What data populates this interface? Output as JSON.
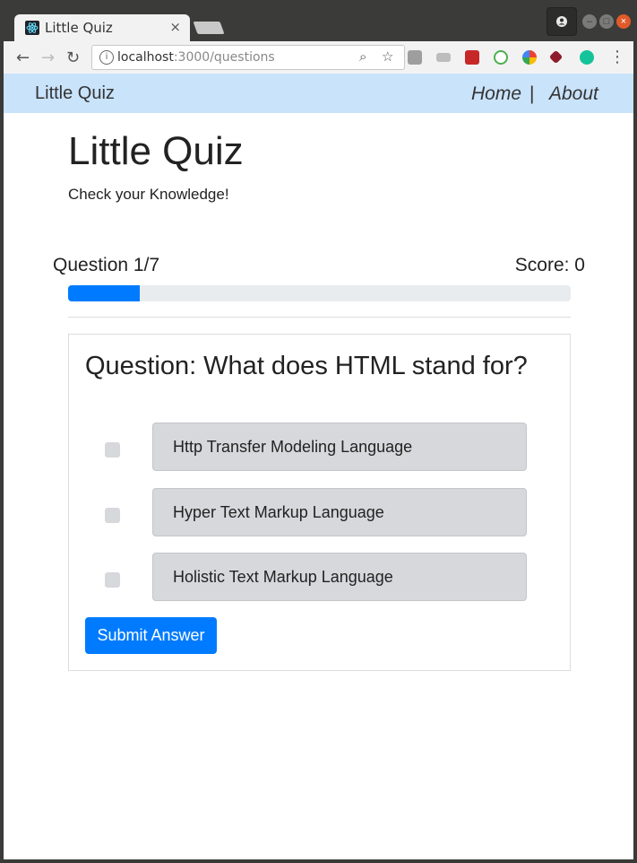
{
  "browser": {
    "tab_title": "Little Quiz",
    "tab_close": "×",
    "url_host": "localhost",
    "url_path": ":3000/questions"
  },
  "navbar": {
    "brand": "Little Quiz",
    "home": "Home",
    "separator": "|",
    "about": "About",
    "background": "#c9e3fb"
  },
  "header": {
    "title": "Little Quiz",
    "subtitle": "Check your Knowledge!"
  },
  "quiz": {
    "counter": "Question 1/7",
    "score": "Score: 0",
    "progress_fraction": 0.142857,
    "accent": "#007bff",
    "question": "Question: What does HTML stand for?",
    "options": [
      "Http Transfer Modeling Language",
      "Hyper Text Markup Language",
      "Holistic Text Markup Language"
    ],
    "submit_label": "Submit Answer"
  }
}
